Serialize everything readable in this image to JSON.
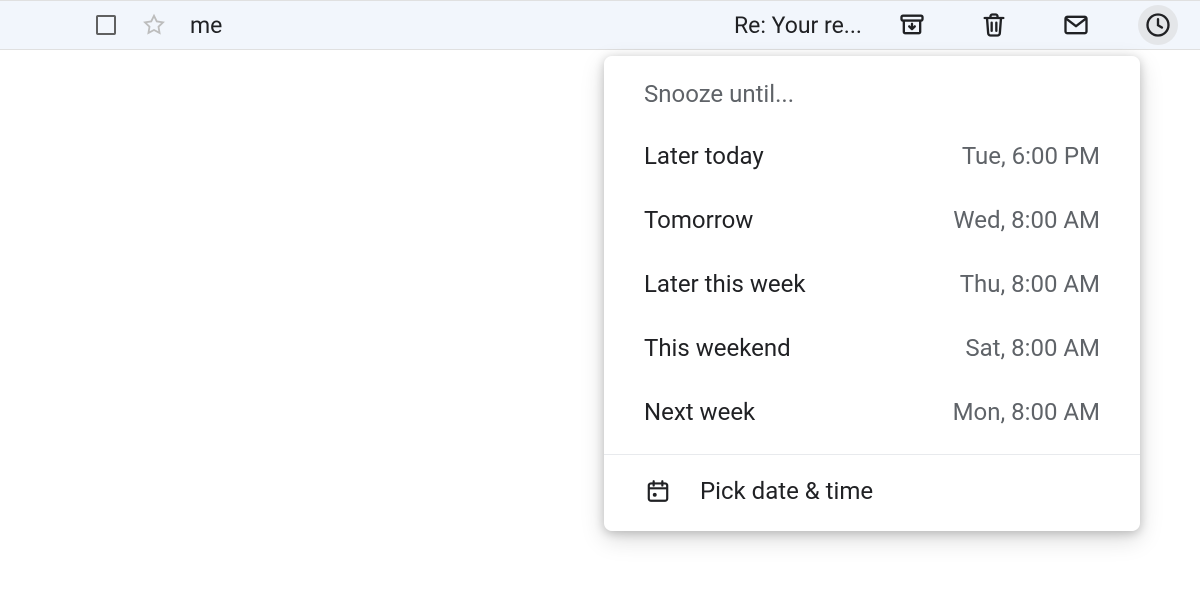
{
  "row": {
    "sender": "me",
    "subject": "Re: Your re..."
  },
  "snooze": {
    "title": "Snooze until...",
    "options": [
      {
        "label": "Later today",
        "time": "Tue, 6:00 PM"
      },
      {
        "label": "Tomorrow",
        "time": "Wed, 8:00 AM"
      },
      {
        "label": "Later this week",
        "time": "Thu, 8:00 AM"
      },
      {
        "label": "This weekend",
        "time": "Sat, 8:00 AM"
      },
      {
        "label": "Next week",
        "time": "Mon, 8:00 AM"
      }
    ],
    "pick": "Pick date & time"
  }
}
